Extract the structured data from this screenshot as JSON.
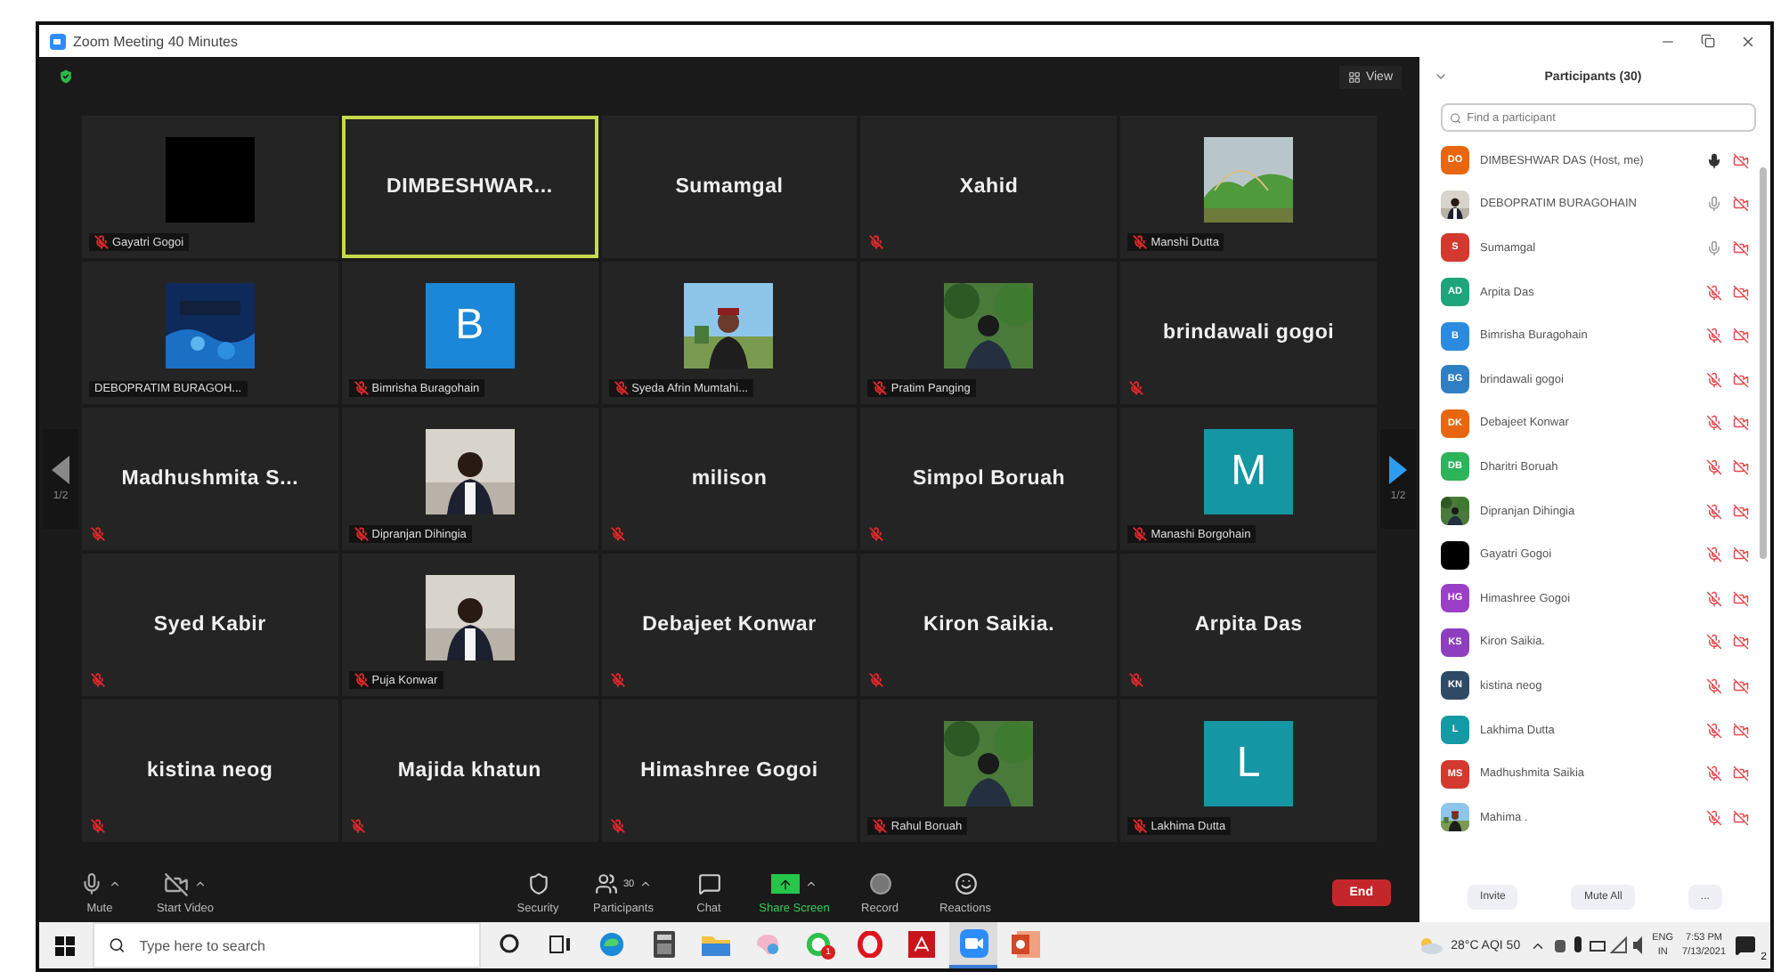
{
  "window": {
    "title": "Zoom Meeting 40 Minutes"
  },
  "view_button": "View",
  "pager": {
    "left": "1/2",
    "right": "1/2"
  },
  "tiles": [
    {
      "kind": "dark",
      "name": "Gayatri Gogoi",
      "muted": true,
      "speaking": false
    },
    {
      "kind": "name",
      "name": "DIMBESHWAR...",
      "muted": false,
      "speaking": true
    },
    {
      "kind": "name",
      "name": "Sumamgal",
      "muted": false,
      "speaking": false
    },
    {
      "kind": "name",
      "name": "Xahid",
      "muted": true,
      "speaking": false
    },
    {
      "name": "Manshi Dutta",
      "muted": true,
      "speaking": false
    },
    {
      "name": "DEBOPRATIM BURAGOH...",
      "muted": false,
      "speaking": false
    },
    {
      "kind": "letter",
      "letter": "B",
      "color": "#1b87d8",
      "name": "Bimrisha Buragohain",
      "muted": true,
      "speaking": false
    },
    {
      "name": "Syeda Afrin Mumtahi...",
      "muted": true,
      "speaking": false
    },
    {
      "name": "Pratim Panging",
      "muted": true,
      "speaking": false
    },
    {
      "kind": "name",
      "name": "brindawali gogoi",
      "muted": true,
      "speaking": false
    },
    {
      "kind": "name",
      "name": "Madhushmita  S...",
      "muted": true,
      "speaking": false
    },
    {
      "name": "Dipranjan Dihingia",
      "muted": true,
      "speaking": false
    },
    {
      "kind": "name",
      "name": "milison",
      "muted": true,
      "speaking": false
    },
    {
      "kind": "name",
      "name": "Simpol Boruah",
      "muted": true,
      "speaking": false
    },
    {
      "kind": "letter",
      "letter": "M",
      "color": "#1597a3",
      "name": "Manashi Borgohain",
      "muted": true,
      "speaking": false
    },
    {
      "kind": "name",
      "name": "Syed Kabir",
      "muted": true,
      "speaking": false
    },
    {
      "name": "Puja Konwar",
      "muted": true,
      "speaking": false
    },
    {
      "kind": "name",
      "name": "Debajeet Konwar",
      "muted": true,
      "speaking": false
    },
    {
      "kind": "name",
      "name": "Kiron Saikia.",
      "muted": true,
      "speaking": false
    },
    {
      "kind": "name",
      "name": "Arpita Das",
      "muted": true,
      "speaking": false
    },
    {
      "kind": "name",
      "name": "kistina neog",
      "muted": true,
      "speaking": false
    },
    {
      "kind": "name",
      "name": "Majida khatun",
      "muted": true,
      "speaking": false
    },
    {
      "kind": "name",
      "name": "Himashree Gogoi",
      "muted": true,
      "speaking": false
    },
    {
      "name": "Rahul Boruah",
      "muted": true,
      "speaking": false
    },
    {
      "kind": "letter",
      "letter": "L",
      "color": "#1597a3",
      "name": "Lakhima Dutta",
      "muted": true,
      "speaking": false
    }
  ],
  "toolbar": [
    {
      "kind": "mic",
      "label": "Mute",
      "caret": true
    },
    {
      "kind": "video",
      "label": "Start Video",
      "caret": true
    },
    {
      "kind": "security",
      "label": "Security",
      "caret": false
    },
    {
      "kind": "participants",
      "label": "Participants",
      "count": "30",
      "caret": true
    },
    {
      "kind": "chat",
      "label": "Chat",
      "caret": false
    },
    {
      "kind": "share",
      "label": "Share Screen",
      "caret": true
    },
    {
      "kind": "record",
      "label": "Record",
      "caret": false
    },
    {
      "kind": "reactions",
      "label": "Reactions",
      "caret": false
    }
  ],
  "end_button": "End",
  "panel": {
    "title": "Participants (30)",
    "search": {
      "placeholder": "Find a participant"
    },
    "participants": [
      {
        "name": "DIMBESHWAR DAS (Host, me)",
        "kind": "initials",
        "initials": "DO",
        "color": "#e8660f",
        "muted": false,
        "speaking": true,
        "video_off": true
      },
      {
        "name": "DEBOPRATIM BURAGOHAIN",
        "muted": false,
        "speaking": false,
        "video_off": true
      },
      {
        "name": "Sumamgal",
        "kind": "initials",
        "initials": "S",
        "color": "#d23a2f",
        "muted": false,
        "speaking": false,
        "video_off": true
      },
      {
        "name": "Arpita Das",
        "kind": "initials",
        "initials": "AD",
        "color": "#1ea57a",
        "muted": true,
        "video_off": true
      },
      {
        "name": "Bimrisha Buragohain",
        "kind": "initials",
        "initials": "B",
        "color": "#2b8be0",
        "muted": true,
        "video_off": true
      },
      {
        "name": "brindawali gogoi",
        "kind": "initials",
        "initials": "BG",
        "color": "#2f7fc4",
        "muted": true,
        "video_off": true
      },
      {
        "name": "Debajeet Konwar",
        "kind": "initials",
        "initials": "DK",
        "color": "#e8660f",
        "muted": true,
        "video_off": true
      },
      {
        "name": "Dharitri Boruah",
        "kind": "initials",
        "initials": "DB",
        "color": "#2db35a",
        "muted": true,
        "video_off": true
      },
      {
        "name": "Dipranjan Dihingia",
        "muted": true,
        "video_off": true
      },
      {
        "name": "Gayatri Gogoi",
        "kind": "dark",
        "muted": true,
        "video_off": true
      },
      {
        "name": "Himashree Gogoi",
        "kind": "initials",
        "initials": "HG",
        "color": "#9b3fc8",
        "muted": true,
        "video_off": true
      },
      {
        "name": "Kiron Saikia.",
        "kind": "initials",
        "initials": "KS",
        "color": "#8e3fc0",
        "muted": true,
        "video_off": true
      },
      {
        "name": "kistina neog",
        "kind": "initials",
        "initials": "KN",
        "color": "#2e4a66",
        "muted": true,
        "video_off": true
      },
      {
        "name": "Lakhima Dutta",
        "kind": "initials",
        "initials": "L",
        "color": "#139aa5",
        "muted": true,
        "video_off": true
      },
      {
        "name": "Madhushmita Saikia",
        "kind": "initials",
        "initials": "MS",
        "color": "#d23a2f",
        "muted": true,
        "video_off": true
      },
      {
        "name": "Mahima .",
        "muted": true,
        "video_off": true
      }
    ],
    "buttons": [
      "Invite",
      "Mute All",
      "..."
    ]
  },
  "taskbar": {
    "search": {
      "placeholder": "Type here to search"
    },
    "apps": [
      {
        "kind": "cortana",
        "selected": false
      },
      {
        "kind": "taskview",
        "selected": false
      },
      {
        "kind": "edge",
        "selected": false
      },
      {
        "kind": "calculator",
        "selected": false
      },
      {
        "kind": "folder",
        "selected": false
      },
      {
        "kind": "paint",
        "selected": false
      },
      {
        "kind": "whatsapp",
        "selected": false,
        "badge": "1"
      },
      {
        "kind": "opera",
        "selected": false
      },
      {
        "kind": "acrobat",
        "selected": false
      },
      {
        "kind": "zoom",
        "selected": true
      },
      {
        "kind": "powerpoint",
        "selected": false
      }
    ],
    "weather": "28°C  AQI 50",
    "language": [
      "ENG",
      "IN"
    ],
    "time": "7:53 PM",
    "date": "7/13/2021",
    "notifications": "2"
  }
}
